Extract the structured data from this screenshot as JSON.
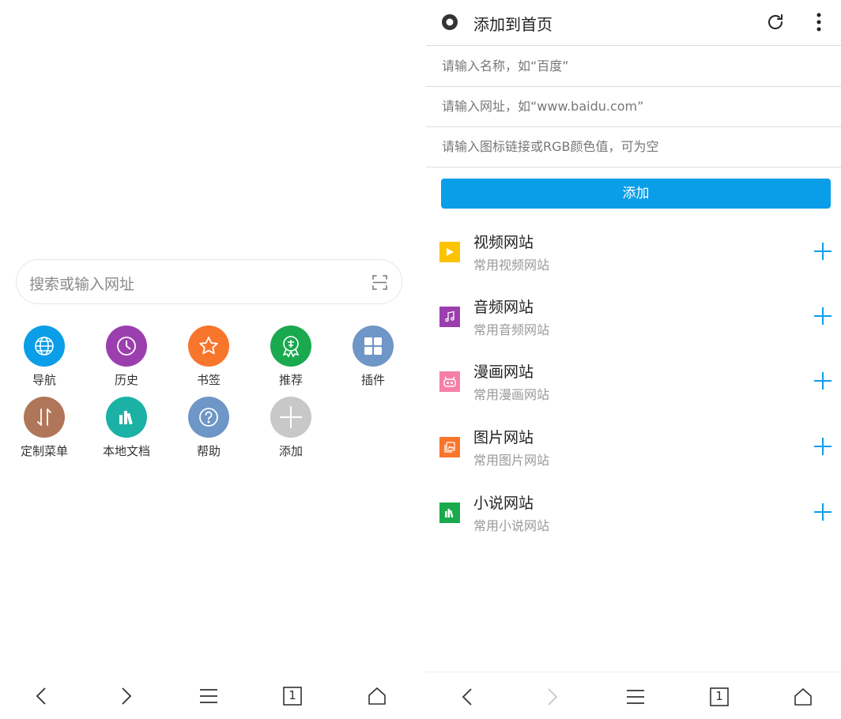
{
  "left": {
    "search": {
      "placeholder": "搜索或输入网址",
      "scan_icon": "scan-icon"
    },
    "grid": [
      {
        "label": "导航",
        "icon": "globe-icon",
        "color": "#0a9ee8"
      },
      {
        "label": "历史",
        "icon": "clock-icon",
        "color": "#9c3fae"
      },
      {
        "label": "书签",
        "icon": "star-icon",
        "color": "#f8752c"
      },
      {
        "label": "推荐",
        "icon": "recommend-badge-icon",
        "color": "#1aa94e"
      },
      {
        "label": "插件",
        "icon": "grid-icon",
        "color": "#6e96c6"
      },
      {
        "label": "定制菜单",
        "icon": "swap-arrows-icon",
        "color": "#b0765a"
      },
      {
        "label": "本地文档",
        "icon": "books-icon",
        "color": "#1bb2a5"
      },
      {
        "label": "帮助",
        "icon": "question-icon",
        "color": "#6e96c6"
      },
      {
        "label": "添加",
        "icon": "plus-icon",
        "color": "#c8c8c8"
      }
    ],
    "bottombar": [
      "back-icon",
      "forward-icon",
      "menu-icon",
      "tabs-icon",
      "home-icon"
    ],
    "tabs_count": "1"
  },
  "right": {
    "header": {
      "title": "添加到首页",
      "logo": "browser-logo-icon",
      "refresh": "refresh-icon",
      "more": "more-vert-icon"
    },
    "fields": {
      "name_placeholder": "请输入名称，如“百度”",
      "url_placeholder": "请输入网址，如“www.baidu.com”",
      "icon_placeholder": "请输入图标链接或RGB颜色值，可为空"
    },
    "add_button": "添加",
    "categories": [
      {
        "title": "视频网站",
        "subtitle": "常用视频网站",
        "icon": "video-play-icon",
        "color": "#fbc300"
      },
      {
        "title": "音频网站",
        "subtitle": "常用音频网站",
        "icon": "music-note-icon",
        "color": "#9c3fae"
      },
      {
        "title": "漫画网站",
        "subtitle": "常用漫画网站",
        "icon": "comic-face-icon",
        "color": "#f57fa7"
      },
      {
        "title": "图片网站",
        "subtitle": "常用图片网站",
        "icon": "image-icon",
        "color": "#f8752c"
      },
      {
        "title": "小说网站",
        "subtitle": "常用小说网站",
        "icon": "books-icon",
        "color": "#1aa94e"
      }
    ],
    "accent": "#0a9ee8",
    "tabs_count": "1"
  }
}
